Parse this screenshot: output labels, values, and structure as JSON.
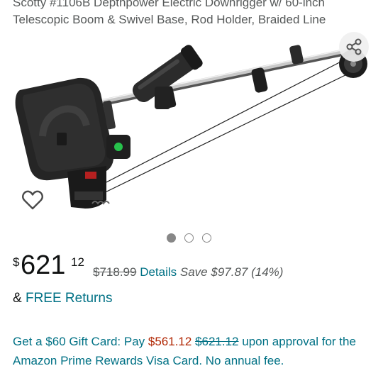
{
  "product": {
    "title_line1": "Scotty #1106B Depthpower Electric Downrigger w/ 60-inch",
    "title_line2": "Telescopic Boom & Swivel Base, Rod Holder, Braided Line"
  },
  "icons": {
    "share": "share-icon",
    "wishlist": "heart-icon"
  },
  "carousel": {
    "total": 3,
    "active_index": 0
  },
  "price": {
    "currency_symbol": "$",
    "whole": "621",
    "fraction": "12",
    "list_price": "$718.99",
    "details_label": "Details",
    "savings": "Save $97.87 (14%)"
  },
  "returns": {
    "prefix": "&",
    "label": "FREE Returns"
  },
  "promo": {
    "text_before": "Get a $60 Gift Card: Pay ",
    "promo_price": "$561.12",
    "strike_price": "$621.12",
    "text_after": " upon approval for the Amazon Prime Rewards Visa Card. No annual fee."
  },
  "colors": {
    "link": "#007185",
    "price_red": "#b12704",
    "text": "#0f1111",
    "muted": "#565959"
  }
}
